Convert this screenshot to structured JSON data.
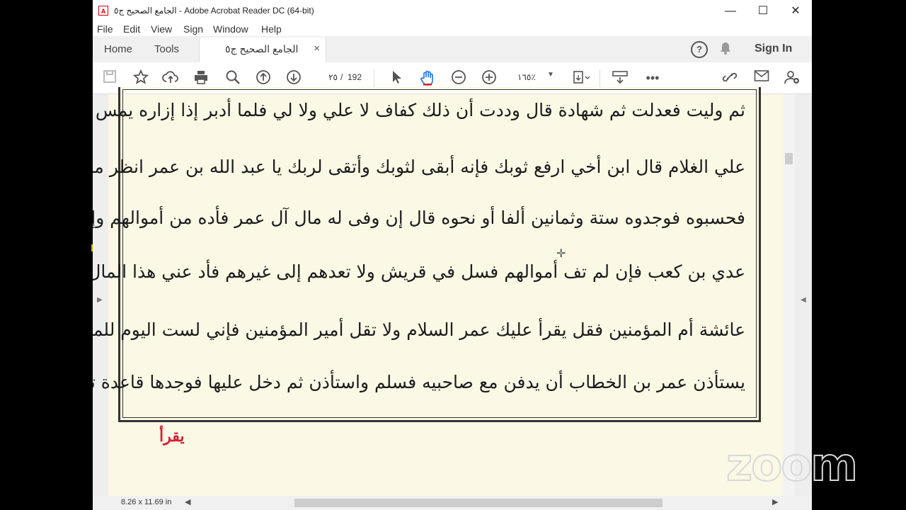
{
  "window": {
    "title": "الجامع الصحيح ج٥ - Adobe Acrobat Reader DC (64-bit)",
    "pdf_icon_glyph": "A",
    "minimize": "—",
    "maximize": "☐",
    "close": "✕"
  },
  "menu": [
    "File",
    "Edit",
    "View",
    "Sign",
    "Window",
    "Help"
  ],
  "tabs": {
    "home": "Home",
    "tools": "Tools",
    "document": "الجامع الصحيح ج٥",
    "document_close": "×",
    "help": "?",
    "sign_in": "Sign In"
  },
  "toolbar": {
    "page_current": "٢٥",
    "page_separator": "/",
    "page_total": "192",
    "zoom": "١٦٥٪",
    "more": "•••"
  },
  "document": {
    "lines": [
      "ثم وليت فعدلت ثم شهادة قال وددت أن ذلك كفاف لا علي ولا لي فلما أدبر إذا إزاره يمس الأرض قال ردوا",
      "علي الغلام قال ابن أخي ارفع ثوبك فإنه أبقى لثوبك وأتقى لربك يا عبد الله بن عمر انظر ما علي من الدين",
      "فحسبوه فوجدوه ستة وثمانين ألفا أو نحوه قال إن وفى له مال آل عمر فأده من أموالهم وإلا فسل في بني",
      "عدي بن كعب فإن لم تف أموالهم فسل في قريش ولا تعدهم إلى غيرهم فأد عني هذا المال انطلق إلى",
      "عائشة أم المؤمنين فقل يقرأ عليك عمر السلام ولا تقل أمير المؤمنين فإني لست اليوم للمؤمنين أميرا وقل",
      "يستأذن عمر بن الخطاب أن يدفن مع صاحبيه فسلم واستأذن ثم دخل عليها فوجدها قاعدة تبكي فقال"
    ],
    "margin_note": "يقرأ"
  },
  "status": {
    "page_size": "8.26 x 11.69 in"
  },
  "overlay": {
    "zoom_logo": "zoom"
  }
}
